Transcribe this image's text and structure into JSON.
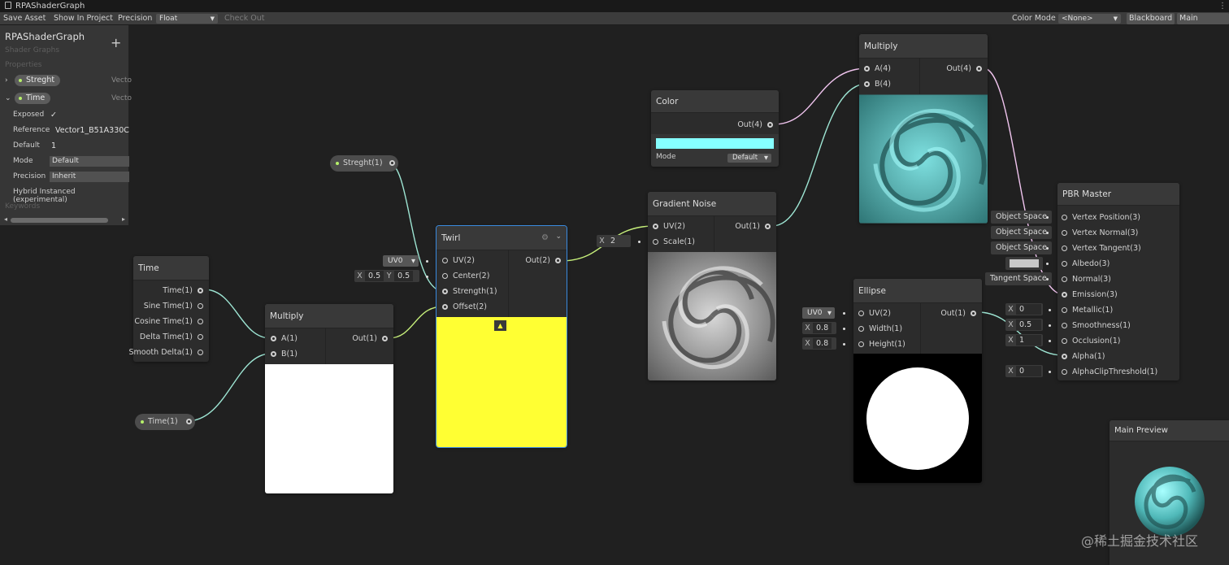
{
  "window": {
    "title": "RPAShaderGraph"
  },
  "toolbar": {
    "save_asset": "Save Asset",
    "show_in_project": "Show In Project",
    "precision_label": "Precision",
    "precision_value": "Float",
    "check_out": "Check Out",
    "color_mode_label": "Color Mode",
    "color_mode_value": "<None>",
    "blackboard": "Blackboard",
    "main_preview": "Main Preview"
  },
  "blackboard": {
    "title": "RPAShaderGraph",
    "subtitle": "Shader Graphs",
    "properties_label": "Properties",
    "keywords_label": "Keywords",
    "props": [
      {
        "name": "Streght",
        "type": "Vecto"
      },
      {
        "name": "Time",
        "type": "Vecto"
      }
    ],
    "attrs": [
      {
        "label": "Exposed",
        "value": "✓"
      },
      {
        "label": "Reference",
        "value": "Vector1_B51A330C"
      },
      {
        "label": "Default",
        "value": "1"
      },
      {
        "label": "Mode",
        "value": "Default"
      },
      {
        "label": "Precision",
        "value": "Inherit"
      },
      {
        "label": "Hybrid Instanced (experimental)",
        "value": ""
      }
    ]
  },
  "nodes": {
    "time": {
      "title": "Time",
      "outputs": [
        "Time(1)",
        "Sine Time(1)",
        "Cosine Time(1)",
        "Delta Time(1)",
        "Smooth Delta(1)"
      ]
    },
    "multiply1": {
      "title": "Multiply",
      "inputs": [
        "A(1)",
        "B(1)"
      ],
      "output": "Out(1)",
      "preview_color": "#ffffff"
    },
    "twirl": {
      "title": "Twirl",
      "inputs": [
        "UV(2)",
        "Center(2)",
        "Strength(1)",
        "Offset(2)"
      ],
      "output": "Out(2)",
      "preview_color": "#ffff33",
      "uv": "UV0",
      "cx": "0.5",
      "cy": "0.5",
      "cx_label": "X",
      "cy_label": "Y"
    },
    "color": {
      "title": "Color",
      "output": "Out(4)",
      "mode_label": "Mode",
      "mode_value": "Default",
      "swatch": "#86ffff"
    },
    "gradient_noise": {
      "title": "Gradient Noise",
      "inputs": [
        "UV(2)",
        "Scale(1)"
      ],
      "output": "Out(1)",
      "scale_label": "X",
      "scale": "2"
    },
    "multiply2": {
      "title": "Multiply",
      "inputs": [
        "A(4)",
        "B(4)"
      ],
      "output": "Out(4)"
    },
    "ellipse": {
      "title": "Ellipse",
      "inputs": [
        "UV(2)",
        "Width(1)",
        "Height(1)"
      ],
      "output": "Out(1)",
      "uv": "UV0",
      "wx": "X",
      "width": "0.8",
      "hx": "X",
      "height": "0.8"
    },
    "pbr": {
      "title": "PBR Master",
      "inputs": [
        "Vertex Position(3)",
        "Vertex Normal(3)",
        "Vertex Tangent(3)",
        "Albedo(3)",
        "Normal(3)",
        "Emission(3)",
        "Metallic(1)",
        "Smoothness(1)",
        "Occlusion(1)",
        "Alpha(1)",
        "AlphaClipThreshold(1)"
      ],
      "spaces": [
        "Object Space",
        "Object Space",
        "Object Space",
        "Tangent Space"
      ],
      "x_label": "X",
      "metallic": "0",
      "smoothness": "0.5",
      "occlusion": "1",
      "alpha_clip": "0",
      "albedo_swatch": "#c8c8c8"
    },
    "streght_prop": {
      "label": "Streght(1)"
    },
    "time_prop": {
      "label": "Time(1)"
    }
  },
  "main_preview": {
    "title": "Main Preview"
  },
  "watermark": "@稀土掘金技术社区",
  "colors": {
    "wire_float": "#9ee6d4",
    "wire_vec2": "#c7f07b",
    "wire_vec4": "#f0c4ee",
    "accent_green": "#b6f06a"
  }
}
